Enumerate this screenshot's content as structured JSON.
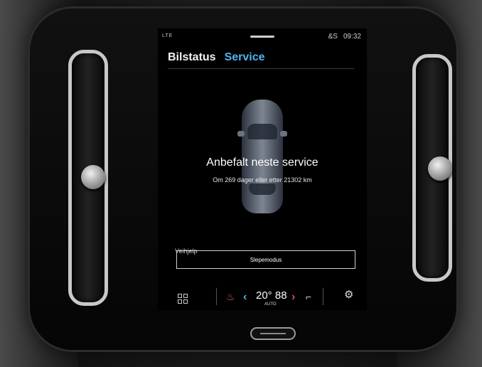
{
  "status_bar": {
    "signal_text": "LTE",
    "user_indicator": "&S",
    "time": "09:32"
  },
  "tabs": [
    {
      "label": "Bilstatus",
      "active": false
    },
    {
      "label": "Service",
      "active": true
    }
  ],
  "service": {
    "title": "Anbefalt neste service",
    "subtitle": "Om 269 dager eller etter 21302 km"
  },
  "assistance": {
    "section_label": "Veihjelp",
    "tow_mode_button": "Slepemodus"
  },
  "climate": {
    "temperature": "20°",
    "fan_glyph": "88",
    "mode_label": "AUTO",
    "apps_icon": "grid-icon",
    "left_seat_icon": "seat-heat-icon",
    "right_seat_icon": "seat-icon",
    "settings_icon": "gear-icon"
  },
  "colors": {
    "accent": "#4fb6ec",
    "temp_down": "#4fb6ec",
    "temp_up": "#e05050"
  }
}
